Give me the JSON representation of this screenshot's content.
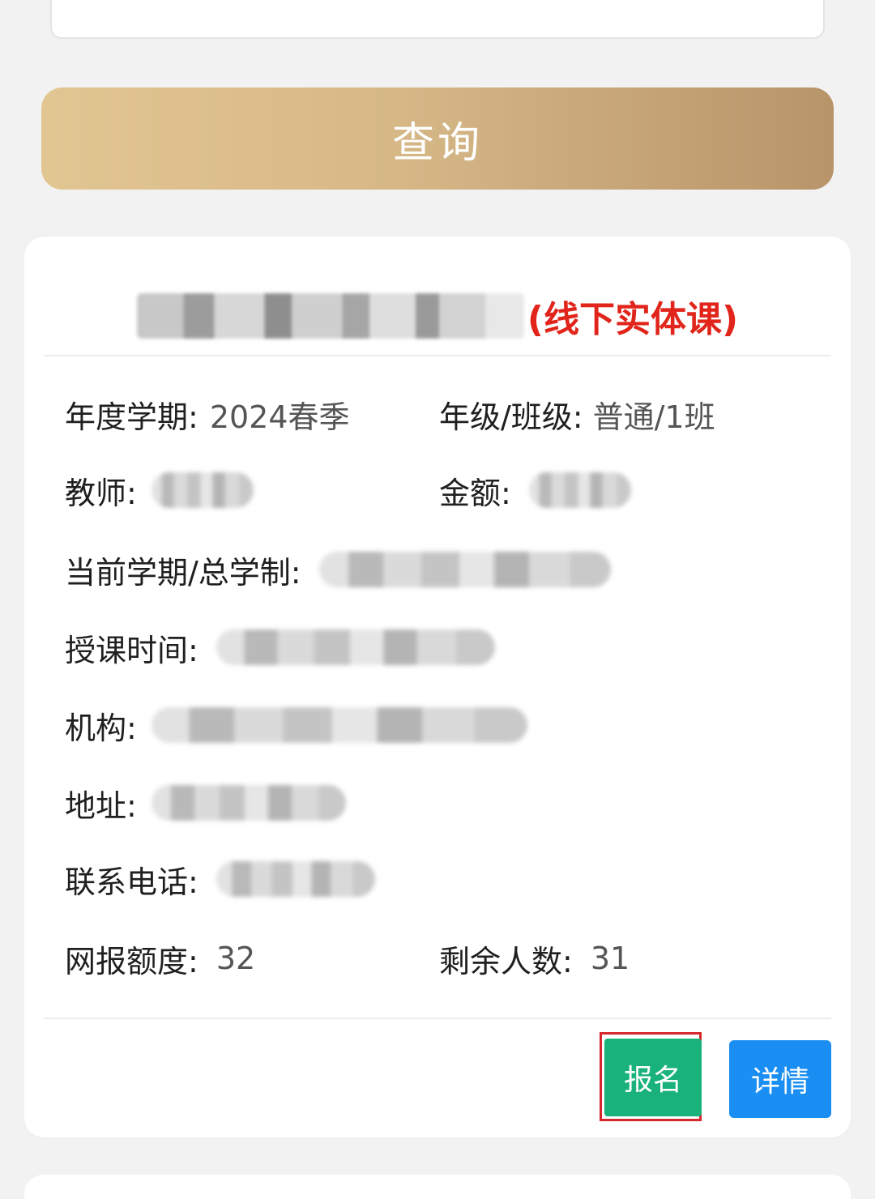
{
  "search": {
    "button_label": "查询"
  },
  "course": {
    "title_suffix": "(线下实体课)",
    "fields": {
      "term_label": "年度学期:",
      "term_value": "2024春季",
      "grade_label": "年级/班级:",
      "grade_value": "普通/1班",
      "teacher_label": "教师:",
      "amount_label": "金额:",
      "current_term_label": "当前学期/总学制:",
      "time_label": "授课时间:",
      "org_label": "机构:",
      "address_label": "地址:",
      "phone_label": "联系电话:",
      "quota_label": "网报额度:",
      "quota_value": "32",
      "remaining_label": "剩余人数:",
      "remaining_value": "31"
    },
    "actions": {
      "enroll_label": "报名",
      "detail_label": "详情"
    }
  },
  "colors": {
    "accent_gold": "#d6b887",
    "title_red": "#e1251b",
    "enroll_green": "#19b27a",
    "detail_blue": "#1a8ef2",
    "highlight_red": "#d6272c"
  }
}
